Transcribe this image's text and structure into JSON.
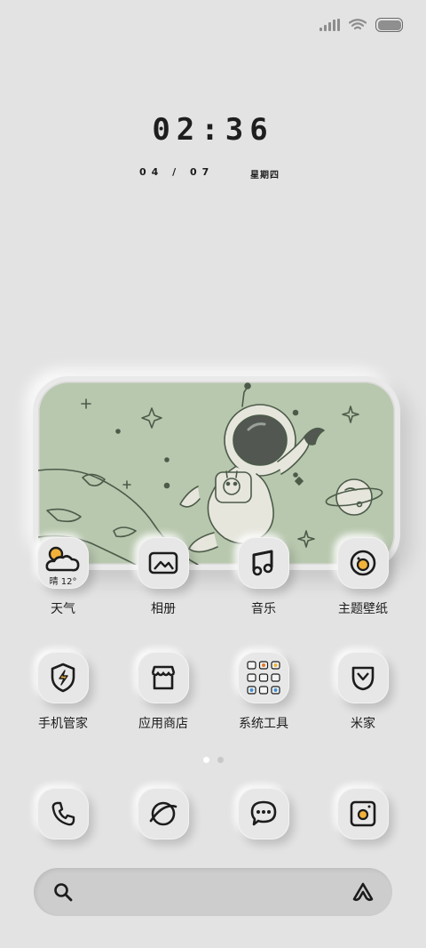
{
  "status_bar": {
    "icons": [
      "signal-icon",
      "wifi-icon",
      "battery-icon"
    ],
    "battery_level": 1.0
  },
  "lockscreen": {
    "time": "02:36",
    "date": "04 / 07",
    "weekday": "星期四"
  },
  "widget": {
    "name": "astronaut-wallpaper-widget"
  },
  "apps_row1": [
    {
      "label": "天气",
      "icon": "weather-icon",
      "badge": "晴 12°"
    },
    {
      "label": "相册",
      "icon": "gallery-icon"
    },
    {
      "label": "音乐",
      "icon": "music-icon"
    },
    {
      "label": "主题壁纸",
      "icon": "themes-icon"
    }
  ],
  "apps_row2": [
    {
      "label": "手机管家",
      "icon": "security-shield-icon"
    },
    {
      "label": "应用商店",
      "icon": "app-store-icon"
    },
    {
      "label": "系统工具",
      "icon": "tools-folder-icon"
    },
    {
      "label": "米家",
      "icon": "mijia-icon"
    }
  ],
  "dock": [
    {
      "icon": "phone-icon"
    },
    {
      "icon": "browser-icon"
    },
    {
      "icon": "messages-icon"
    },
    {
      "icon": "camera-icon"
    }
  ],
  "page_indicator": {
    "count": 2,
    "active": 1
  },
  "search_bar": {
    "left_icon": "search-icon",
    "right_icon": "assistant-icon"
  },
  "colors": {
    "background": "#e3e3e3",
    "widget_green": "#b8c8ae",
    "accent_yellow": "#f2b23a"
  }
}
